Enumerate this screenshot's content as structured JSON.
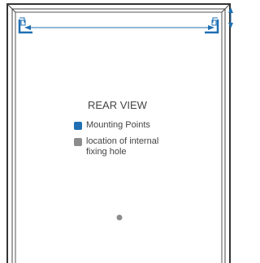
{
  "diagram": {
    "title": "REAR VIEW",
    "legend": [
      {
        "label": "Mounting Points",
        "color": "#1f6fb2",
        "icon": "blue-square-swatch"
      },
      {
        "label": "location of internal fixing hole",
        "color": "#8c8c8c",
        "icon": "grey-square-swatch"
      }
    ],
    "colors": {
      "frame": "#333333",
      "dimension_line": "#1f6fb2",
      "bracket": "#1f6fb2",
      "fixing_hole": "#8c8c8c"
    }
  }
}
